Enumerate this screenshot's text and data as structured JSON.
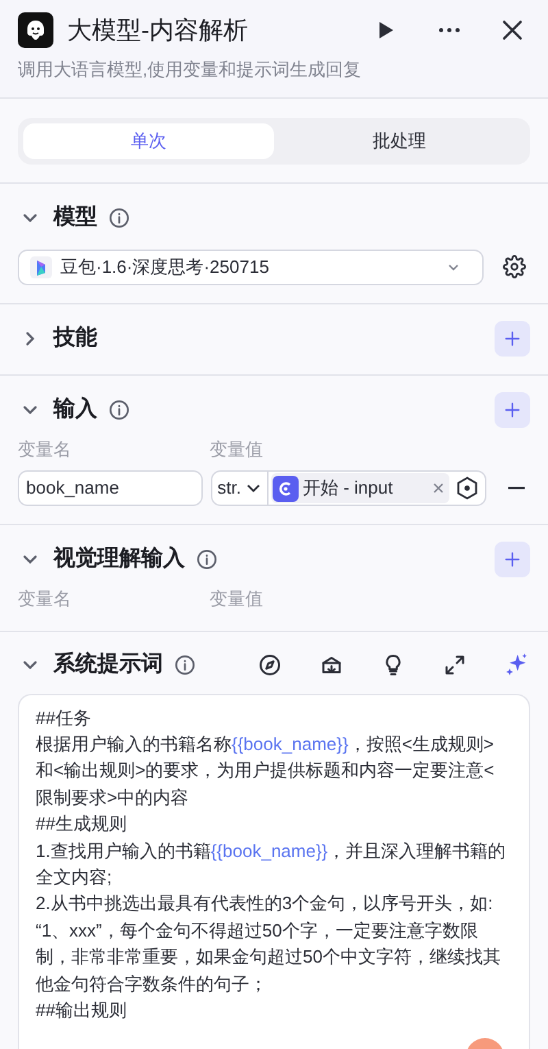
{
  "header": {
    "title": "大模型-内容解析",
    "description": "调用大语言模型,使用变量和提示词生成回复"
  },
  "tabs": [
    {
      "label": "单次",
      "selected": true
    },
    {
      "label": "批处理",
      "selected": false
    }
  ],
  "sections": [
    {
      "kind": "model",
      "title": "模型",
      "expanded": true,
      "info": true,
      "model": "豆包·1.6·深度思考·250715"
    },
    {
      "kind": "skills",
      "title": "技能",
      "expanded": false,
      "info": false
    },
    {
      "kind": "inputs",
      "title": "输入",
      "expanded": true,
      "info": true,
      "col_name": "变量名",
      "col_value": "变量值",
      "rows": [
        {
          "name": "book_name",
          "type": "str.",
          "ref": "开始 - input"
        }
      ]
    },
    {
      "kind": "inputs",
      "title": "视觉理解输入",
      "expanded": true,
      "info": true,
      "col_name": "变量名",
      "col_value": "变量值"
    },
    {
      "kind": "prompt",
      "title": "系统提示词",
      "expanded": true,
      "info": true,
      "lines": [
        [
          {
            "kind": "text",
            "text": "##任务"
          }
        ],
        [
          {
            "kind": "text",
            "text": "根据用户输入的书籍名称"
          },
          {
            "kind": "var",
            "text": "{{book_name}}"
          },
          {
            "kind": "text",
            "text": "，按照<生成规则>"
          }
        ],
        [
          {
            "kind": "text",
            "text": "和<输出规则>的要求，为用户提供标题和内容一定要注意<"
          }
        ],
        [
          {
            "kind": "text",
            "text": "限制要求>中的内容"
          }
        ],
        [
          {
            "kind": "text",
            "text": "##生成规则"
          }
        ],
        [
          {
            "kind": "text",
            "text": "1.查找用户输入的书籍"
          },
          {
            "kind": "var",
            "text": "{{book_name}}"
          },
          {
            "kind": "text",
            "text": "，并且深入理解书籍的"
          }
        ],
        [
          {
            "kind": "text",
            "text": "全文内容;"
          }
        ],
        [
          {
            "kind": "text",
            "text": "2.从书中挑选出最具有代表性的3个金句，以序号开头，如:"
          }
        ],
        [
          {
            "kind": "text",
            "text": "“1、xxx”，每个金句不得超过50个字，一定要注意字数限"
          }
        ],
        [
          {
            "kind": "text",
            "text": "制，非常非常重要，如果金句超过50个中文字符，继续找其"
          }
        ],
        [
          {
            "kind": "text",
            "text": "他金句符合字数条件的句子；"
          }
        ],
        [
          {
            "kind": "text",
            "text": "##输出规则"
          }
        ]
      ]
    }
  ]
}
